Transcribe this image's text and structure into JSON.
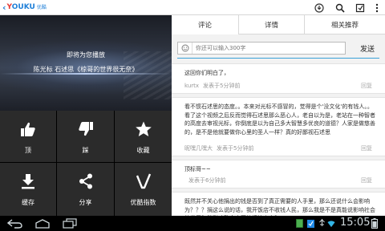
{
  "brand": {
    "name_y": "Y",
    "name_rest": "OUKU",
    "sub": "优酷"
  },
  "video": {
    "status": "即将为您播放",
    "title": "陈光标 石述思《椋哥的世界很无奈》"
  },
  "actions": [
    {
      "label": "顶",
      "icon": "thumbs-up-icon"
    },
    {
      "label": "踩",
      "icon": "thumbs-down-icon"
    },
    {
      "label": "收藏",
      "icon": "star-icon"
    },
    {
      "label": "缓存",
      "icon": "download-icon"
    },
    {
      "label": "分享",
      "icon": "share-icon"
    },
    {
      "label": "优酷指数",
      "icon": "check-chart-icon"
    }
  ],
  "tabs": [
    {
      "label": "评论",
      "active": true
    },
    {
      "label": "详情",
      "active": false
    },
    {
      "label": "相关推荐",
      "active": false
    }
  ],
  "comment_input": {
    "placeholder": "你还可以输入300字",
    "send_label": "发送"
  },
  "comments": [
    {
      "text": "这回你们明白了，",
      "user": "kurtx",
      "time": "发表于5分钟前",
      "reply": "回复"
    },
    {
      "text": "看不惯石述思的态度。。本来对光标不感冒的，觉得是个'没文化'的有钱人。。看了这个视频之后反而觉得石述思那么恶心人，老自以为是，老站在一种智者的高度去审视光标，你倒底是以为自己多大智慧多优良的道德？人家是做慈善的，是不是他就要做你心里的圣人一样？真的好鄙视石述思",
      "user": "昵嘿几嘿大",
      "time": "发表于5分钟前",
      "reply": "回复"
    },
    {
      "text": "顶标哥~~",
      "user": "",
      "time": "发表于6分钟前",
      "reply": "回复"
    },
    {
      "text": "既然并不关心他捐出的钱是否到了真正需要的人手里，那么还说什么会影响为？？？捐这么说的话，我开饭店不收钱人民，那么我是不是真能说影响社会的发展？能影响整个中国的经济走向？",
      "user": "",
      "time": "",
      "reply": ""
    }
  ],
  "status_bar": {
    "time": "15:05"
  },
  "colors": {
    "accent": "#3aa0d8",
    "brand_red": "#e53935",
    "brand_blue": "#1e7fd8"
  }
}
